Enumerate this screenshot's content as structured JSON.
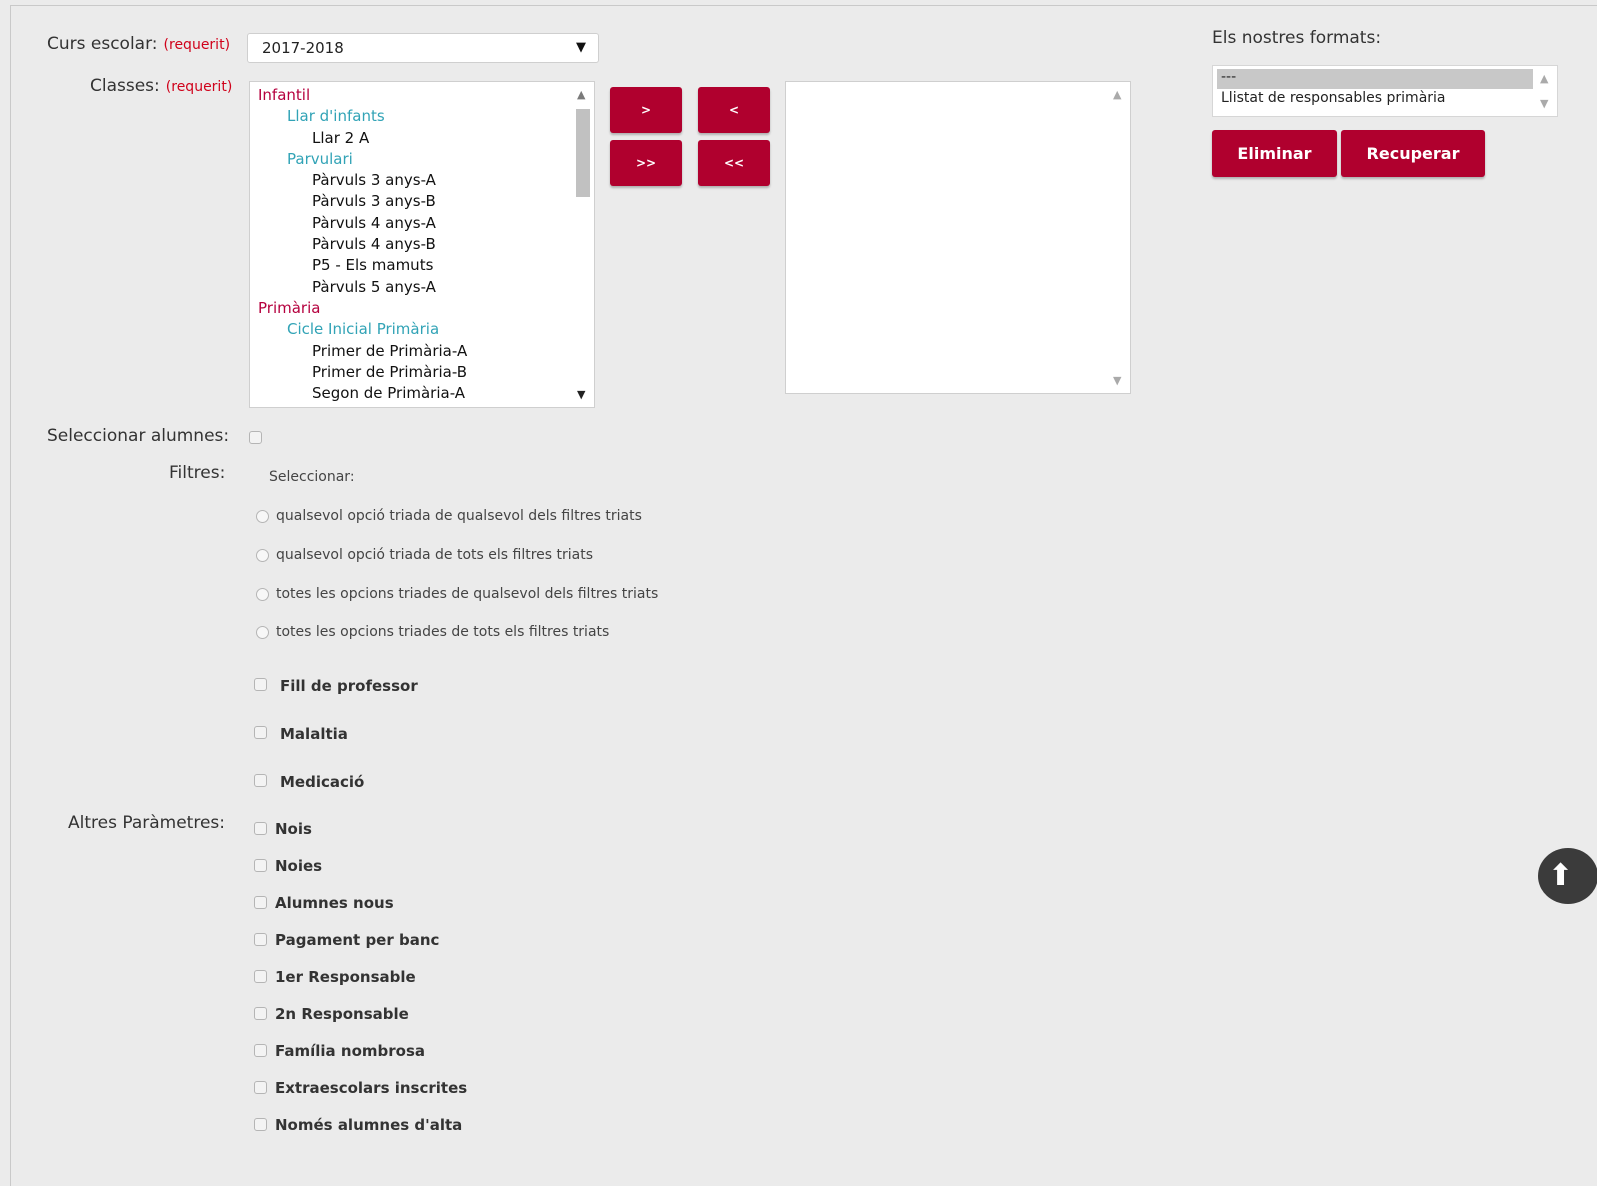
{
  "form": {
    "curs_label": "Curs escolar:",
    "classes_label": "Classes:",
    "required_text": "(requerit)",
    "curs_value": "2017-2018",
    "seleccionar_alumnes_label": "Seleccionar alumnes:",
    "filtres_label": "Filtres:",
    "altres_label": "Altres Paràmetres:"
  },
  "classes_list": [
    {
      "label": "Infantil",
      "level": 0
    },
    {
      "label": "Llar d'infants",
      "level": 1
    },
    {
      "label": "Llar 2 A",
      "level": 2
    },
    {
      "label": "Parvulari",
      "level": 1
    },
    {
      "label": "Pàrvuls 3 anys-A",
      "level": 2
    },
    {
      "label": "Pàrvuls 3 anys-B",
      "level": 2
    },
    {
      "label": "Pàrvuls 4 anys-A",
      "level": 2
    },
    {
      "label": "Pàrvuls 4 anys-B",
      "level": 2
    },
    {
      "label": "P5 - Els mamuts",
      "level": 2
    },
    {
      "label": "Pàrvuls 5 anys-A",
      "level": 2
    },
    {
      "label": "Primària",
      "level": 0
    },
    {
      "label": "Cicle Inicial Primària",
      "level": 1
    },
    {
      "label": "Primer de Primària-A",
      "level": 2
    },
    {
      "label": "Primer de Primària-B",
      "level": 2
    },
    {
      "label": "Segon de Primària-A",
      "level": 2
    }
  ],
  "transfer_buttons": {
    "add": ">",
    "add_all": ">>",
    "remove": "<",
    "remove_all": "<<"
  },
  "formats": {
    "label": "Els nostres formats:",
    "options": [
      "---",
      "Llistat de responsables primària"
    ],
    "selected": "---",
    "delete_label": "Eliminar",
    "recover_label": "Recuperar"
  },
  "filtres": {
    "select_label": "Seleccionar:",
    "radio_options": [
      "qualsevol opció triada de qualsevol dels filtres triats",
      "qualsevol opció triada de tots els filtres triats",
      "totes les opcions triades de qualsevol dels filtres triats",
      "totes les opcions triades de tots els filtres triats"
    ],
    "checkboxes": [
      "Fill de professor",
      "Malaltia",
      "Medicació"
    ]
  },
  "altres": [
    "Nois",
    "Noies",
    "Alumnes nous",
    "Pagament per banc",
    "1er Responsable",
    "2n Responsable",
    "Família nombrosa",
    "Extraescolars inscrites",
    "Només alumnes d'alta"
  ],
  "colors": {
    "accent": "#b0002e",
    "level0": "#b5003e",
    "level1": "#31a3b6",
    "required": "#d0021b"
  }
}
